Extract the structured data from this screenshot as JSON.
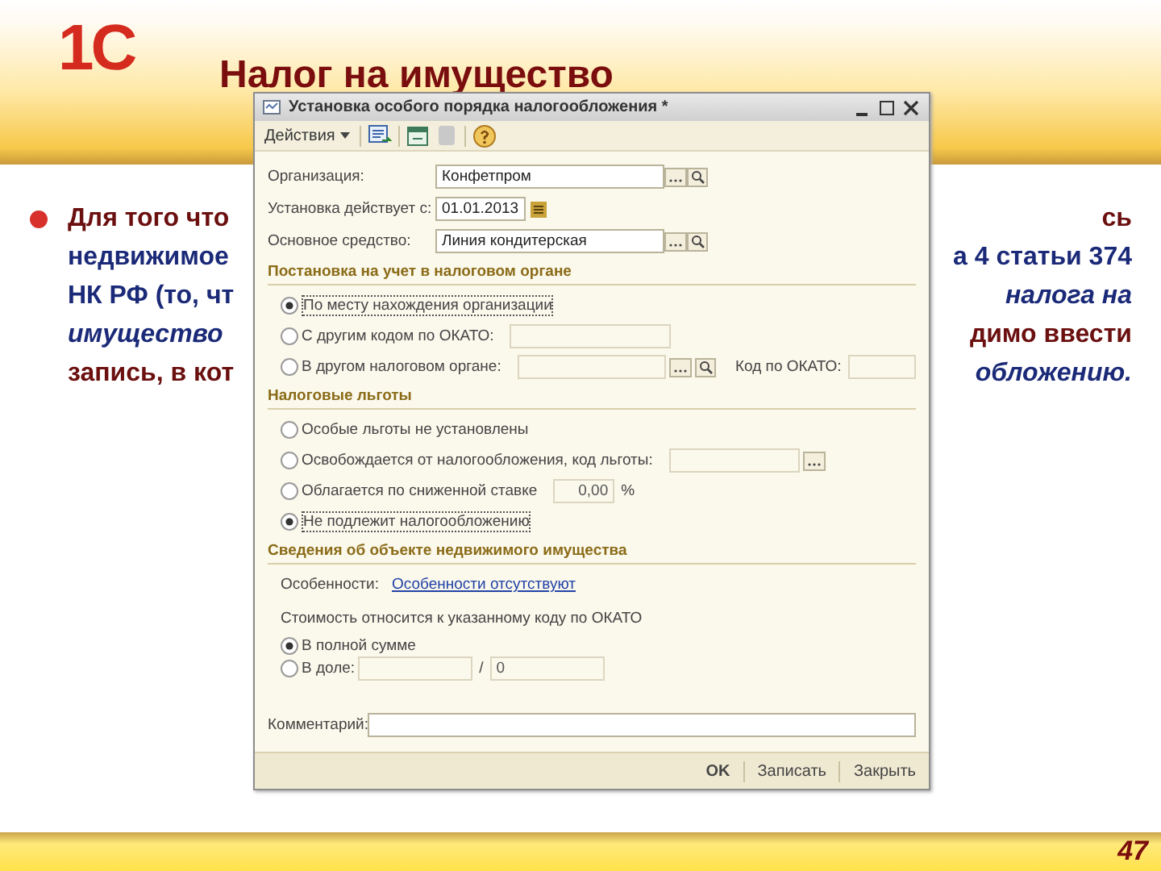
{
  "slide": {
    "logo": "1С",
    "title": "Налог на имущество",
    "page": "47",
    "lines": [
      {
        "left": {
          "text": "Для того что",
          "kind": "red",
          "italic": false
        },
        "right": {
          "text": "сь",
          "kind": "red",
          "italic": false
        }
      },
      {
        "left": {
          "text": "недвижимое",
          "kind": "blue",
          "italic": false
        },
        "right": {
          "text": "а 4 статьи 374",
          "kind": "blue",
          "italic": false
        }
      },
      {
        "left": {
          "text": "НК РФ (то, чт",
          "kind": "blue",
          "italic": false
        },
        "right": {
          "text": "налога на",
          "kind": "blue",
          "italic": true
        }
      },
      {
        "left": {
          "text": "имущество",
          "kind": "blue",
          "italic": true
        },
        "right": {
          "text": "димо ввести",
          "kind": "red",
          "italic": false
        }
      },
      {
        "left": {
          "text": "запись, в кот",
          "kind": "red",
          "italic": false
        },
        "right": {
          "text": "обложению.",
          "kind": "blue",
          "italic": true
        }
      }
    ]
  },
  "window": {
    "title": "Установка особого порядка налогообложения *",
    "menu": "Действия",
    "fields": [
      {
        "label": "Организация:",
        "value": "Конфетпром",
        "kind": "lookup"
      },
      {
        "label": "Установка действует с:",
        "value": "01.01.2013",
        "kind": "date"
      },
      {
        "label": "Основное средство:",
        "value": "Линия кондитерская",
        "kind": "lookup"
      }
    ],
    "sections": [
      {
        "title": "Постановка на учет в налоговом органе",
        "options": [
          {
            "label": "По месту нахождения организации",
            "selected": true,
            "kind": "plain"
          },
          {
            "label": "С другим кодом по ОКАТО:",
            "selected": false,
            "kind": "field"
          },
          {
            "label": "В другом налоговом органе:",
            "selected": false,
            "kind": "lookup",
            "extra_label": "Код по ОКАТО:"
          }
        ]
      },
      {
        "title": "Налоговые льготы",
        "options": [
          {
            "label": "Особые льготы не установлены",
            "selected": false,
            "kind": "plain"
          },
          {
            "label": "Освобождается от налогообложения, код льготы:",
            "selected": false,
            "kind": "choice"
          },
          {
            "label": "Облагается по сниженной ставке",
            "selected": false,
            "kind": "rate",
            "value": "0,00",
            "unit": "%"
          },
          {
            "label": "Не подлежит налогообложению",
            "selected": true,
            "kind": "plain"
          }
        ]
      },
      {
        "title": "Сведения об объекте недвижимого имущества",
        "feature": {
          "label": "Особенности:",
          "link": "Особенности отсутствуют"
        },
        "note": "Стоимость относится к указанному коду по ОКАТО",
        "options": [
          {
            "label": "В полной сумме",
            "selected": true,
            "kind": "plain"
          },
          {
            "label": "В доле:",
            "selected": false,
            "kind": "share",
            "separator": "/",
            "value": "0"
          }
        ]
      }
    ],
    "comment": "Комментарий:",
    "buttons": [
      "OK",
      "Записать",
      "Закрыть"
    ]
  }
}
